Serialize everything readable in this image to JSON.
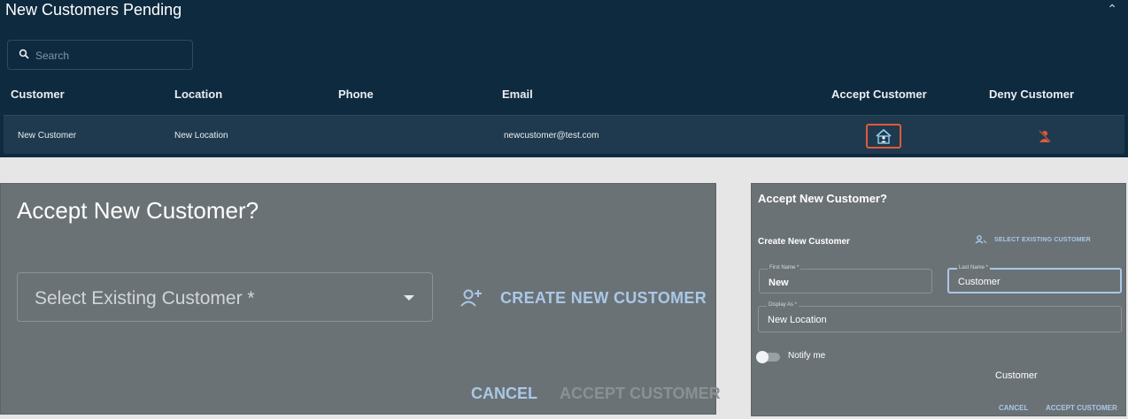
{
  "pending_panel": {
    "title": "New Customers Pending",
    "search_placeholder": "Search",
    "columns": [
      "Customer",
      "Location",
      "Phone",
      "Email",
      "Accept Customer",
      "Deny Customer"
    ],
    "rows": [
      {
        "customer": "New Customer",
        "location": "New Location",
        "phone": "",
        "email": "newcustomer@test.com"
      }
    ],
    "accept_icon": "home-person-icon",
    "deny_icon": "person-off-icon",
    "accent_color": "#e05a3a"
  },
  "accept_dialog": {
    "title": "Accept New Customer?",
    "select_label": "Select Existing Customer *",
    "create_new_label": "CREATE NEW CUSTOMER",
    "cancel_label": "CANCEL",
    "accept_label": "ACCEPT CUSTOMER"
  },
  "create_dialog": {
    "title": "Accept New Customer?",
    "subtitle": "Create New Customer",
    "select_existing_label": "SELECT EXISTING CUSTOMER",
    "first_name_label": "First Name *",
    "first_name_value": "New",
    "last_name_label": "Last Name *",
    "last_name_value": "Customer",
    "display_as_label": "Display As *",
    "display_as_value": "New Location",
    "notify_label": "Notify me",
    "notify_on": false,
    "customer_text": "Customer",
    "cancel_label": "CANCEL",
    "accept_label": "ACCEPT CUSTOMER"
  }
}
